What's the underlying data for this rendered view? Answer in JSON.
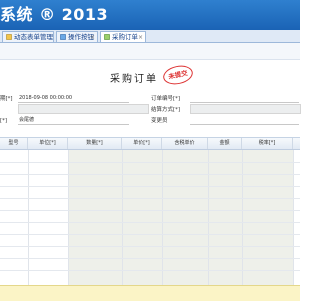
{
  "header": {
    "title": "系统 ® 2013"
  },
  "tabs": [
    {
      "label": "动态表单管理",
      "icon": "form-icon",
      "active": false
    },
    {
      "label": "操作按钮",
      "icon": "button-icon",
      "active": false
    },
    {
      "label": "采购订单",
      "icon": "order-icon",
      "active": true
    }
  ],
  "tab_close": "×",
  "form": {
    "title": "采购订单",
    "stamp": "未提交",
    "left_fields": [
      {
        "label": "期[*]",
        "value": "2018-09-08 00:00:00"
      },
      {
        "label": "",
        "value": ""
      },
      {
        "label": "[*]",
        "value": "会尾德"
      }
    ],
    "right_fields": [
      {
        "label": "订单编号[*]",
        "value": ""
      },
      {
        "label": "结算方式[*]",
        "value": ""
      },
      {
        "label": "变更员",
        "value": ""
      }
    ]
  },
  "table": {
    "columns": [
      "型号",
      "单位[*]",
      "数量[*]",
      "单价[*]",
      "含税单价",
      "金额",
      "税率[*]"
    ]
  },
  "colors": {
    "banner": "#1a63b5",
    "stamp": "#d33333",
    "footer": "#fbf4c6"
  }
}
